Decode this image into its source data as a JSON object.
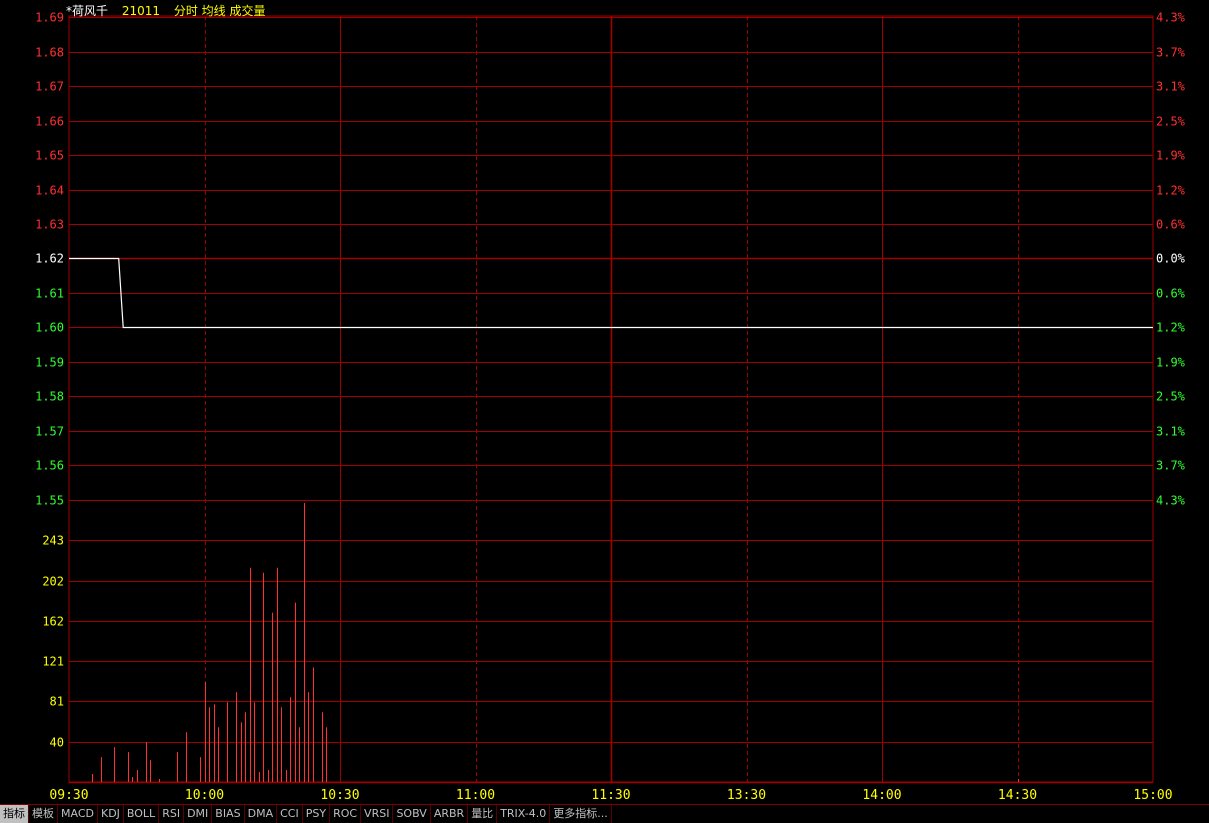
{
  "header": {
    "name": "*荷风千",
    "code": "21011",
    "indicators": "分时 均线 成交量"
  },
  "tabs": [
    "指标",
    "模板",
    "MACD",
    "KDJ",
    "BOLL",
    "RSI",
    "DMI",
    "BIAS",
    "DMA",
    "CCI",
    "PSY",
    "ROC",
    "VRSI",
    "SOBV",
    "ARBR",
    "量比",
    "TRIX-4.0",
    "更多指标..."
  ],
  "colors": {
    "background": "#000000",
    "grid": "#a00000",
    "up": "#ff3030",
    "down": "#30ff30",
    "neutral": "#ffffff",
    "volume_axis": "#ffff00",
    "price_line": "#ffffff"
  },
  "chart_data": {
    "type": "line",
    "price_axis": {
      "ticks": [
        "1.69",
        "1.68",
        "1.67",
        "1.66",
        "1.65",
        "1.64",
        "1.63",
        "1.62",
        "1.61",
        "1.60",
        "1.59",
        "1.58",
        "1.57",
        "1.56",
        "1.55"
      ],
      "reference": 1.62,
      "ylim": [
        1.55,
        1.69
      ]
    },
    "pct_axis": {
      "ticks": [
        "4.3%",
        "3.7%",
        "3.1%",
        "2.5%",
        "1.9%",
        "1.2%",
        "0.6%",
        "0.0%",
        "0.6%",
        "1.2%",
        "1.9%",
        "2.5%",
        "3.1%",
        "3.7%",
        "4.3%"
      ]
    },
    "volume_axis": {
      "ticks": [
        "243",
        "202",
        "162",
        "121",
        "81",
        "40"
      ],
      "ylim": [
        0,
        283
      ]
    },
    "time_axis": {
      "ticks": [
        "09:30",
        "10:00",
        "10:30",
        "11:00",
        "11:30",
        "13:30",
        "14:00",
        "14:30",
        "15:00"
      ],
      "minutes_per_day": 240
    },
    "series": [
      {
        "type": "line",
        "points": [
          [
            0,
            1.62
          ],
          [
            11,
            1.62
          ],
          [
            12,
            1.6
          ],
          [
            240,
            1.6
          ]
        ]
      },
      {
        "type": "bar",
        "points": [
          [
            5,
            8
          ],
          [
            7,
            25
          ],
          [
            10,
            35
          ],
          [
            13,
            30
          ],
          [
            14,
            5
          ],
          [
            15,
            12
          ],
          [
            17,
            40
          ],
          [
            18,
            22
          ],
          [
            20,
            3
          ],
          [
            24,
            30
          ],
          [
            26,
            50
          ],
          [
            29,
            25
          ],
          [
            30,
            100
          ],
          [
            31,
            75
          ],
          [
            32,
            78
          ],
          [
            33,
            55
          ],
          [
            35,
            80
          ],
          [
            37,
            90
          ],
          [
            38,
            60
          ],
          [
            39,
            70
          ],
          [
            40,
            215
          ],
          [
            41,
            80
          ],
          [
            42,
            10
          ],
          [
            43,
            210
          ],
          [
            44,
            12
          ],
          [
            45,
            170
          ],
          [
            46,
            215
          ],
          [
            47,
            75
          ],
          [
            48,
            12
          ],
          [
            49,
            85
          ],
          [
            50,
            180
          ],
          [
            51,
            55
          ],
          [
            52,
            280
          ],
          [
            53,
            90
          ],
          [
            54,
            115
          ],
          [
            56,
            70
          ],
          [
            57,
            55
          ],
          [
            210,
            3
          ]
        ]
      }
    ]
  }
}
